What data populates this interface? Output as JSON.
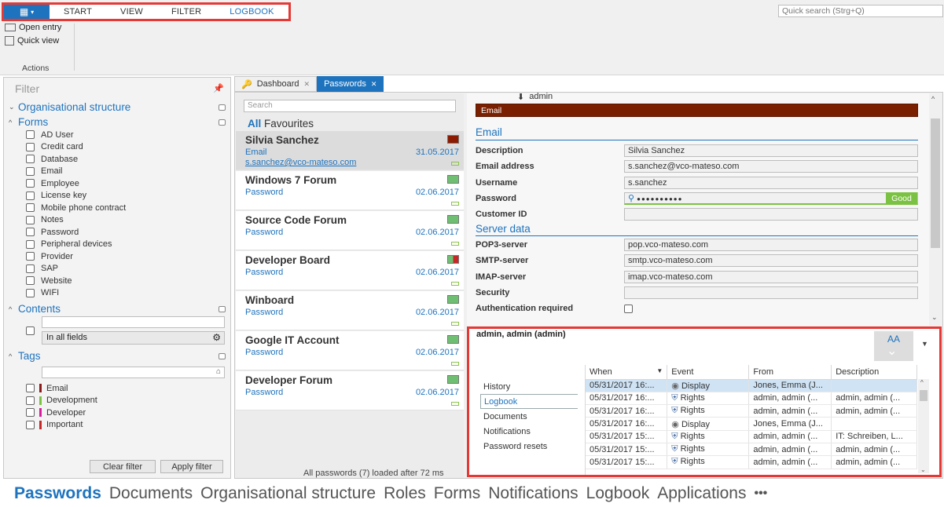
{
  "ribbon": {
    "tabs": [
      "START",
      "VIEW",
      "FILTER",
      "LOGBOOK"
    ],
    "active_tab": "LOGBOOK",
    "quick_search_placeholder": "Quick search (Strg+Q)",
    "actions": {
      "open_entry": "Open entry",
      "quick_view": "Quick view",
      "group_label": "Actions"
    }
  },
  "filter": {
    "title": "Filter",
    "sections": {
      "org": "Organisational structure",
      "forms": "Forms",
      "contents": "Contents",
      "tags": "Tags"
    },
    "forms_items": [
      "AD User",
      "Credit card",
      "Database",
      "Email",
      "Employee",
      "License key",
      "Mobile phone contract",
      "Notes",
      "Password",
      "Peripheral devices",
      "Provider",
      "SAP",
      "Website",
      "WIFI"
    ],
    "contents_scope": "In all fields",
    "tag_items": [
      {
        "label": "Email",
        "color": "#8b1a1a"
      },
      {
        "label": "Development",
        "color": "#7cc242"
      },
      {
        "label": "Developer",
        "color": "#d81b9c"
      },
      {
        "label": "Important",
        "color": "#c62828"
      }
    ],
    "clear_filter": "Clear filter",
    "apply_filter": "Apply filter"
  },
  "doc_tabs": [
    {
      "label": "Dashboard",
      "close": "✕"
    },
    {
      "label": "Passwords",
      "close": "✕"
    }
  ],
  "list": {
    "search_placeholder": "Search",
    "all_label": "All",
    "favourites_label": "Favourites",
    "entries": [
      {
        "title": "Silvia Sanchez",
        "type": "Email",
        "date": "31.05.2017",
        "sub": "s.sanchez@vco-mateso.com",
        "flag": "#8b1a00"
      },
      {
        "title": "Windows 7 Forum",
        "type": "Password",
        "date": "02.06.2017",
        "flag": "#6fbf73"
      },
      {
        "title": "Source Code Forum",
        "type": "Password",
        "date": "02.06.2017",
        "flag": "#6fbf73"
      },
      {
        "title": "Developer Board",
        "type": "Password",
        "date": "02.06.2017",
        "flag": "#6fbf73"
      },
      {
        "title": "Winboard",
        "type": "Password",
        "date": "02.06.2017",
        "flag": "#6fbf73"
      },
      {
        "title": "Google IT Account",
        "type": "Password",
        "date": "02.06.2017",
        "flag": "#6fbf73"
      },
      {
        "title": "Developer Forum",
        "type": "Password",
        "date": "02.06.2017",
        "flag": "#6fbf73"
      }
    ],
    "footer": "All passwords (7) loaded after 72 ms"
  },
  "detail": {
    "owner": "admin",
    "tag_bar": "Email",
    "section_email": "Email",
    "fields_email": [
      {
        "label": "Description",
        "value": "Silvia Sanchez"
      },
      {
        "label": "Email address",
        "value": "s.sanchez@vco-mateso.com"
      },
      {
        "label": "Username",
        "value": "s.sanchez"
      },
      {
        "label": "Password",
        "value": "●●●●●●●●●●"
      },
      {
        "label": "Customer ID",
        "value": ""
      }
    ],
    "password_strength": "Good",
    "section_server": "Server data",
    "fields_server": [
      {
        "label": "POP3-server",
        "value": "pop.vco-mateso.com"
      },
      {
        "label": "SMTP-server",
        "value": "smtp.vco-mateso.com"
      },
      {
        "label": "IMAP-server",
        "value": "imap.vco-mateso.com"
      },
      {
        "label": "Security",
        "value": ""
      },
      {
        "label": "Authentication required",
        "value": ""
      }
    ]
  },
  "logbook": {
    "user": "admin, admin (admin)",
    "avatar_initials": "AA",
    "nav": [
      "History",
      "Logbook",
      "Documents",
      "Notifications",
      "Password resets"
    ],
    "active_nav": "Logbook",
    "columns": [
      "When",
      "Event",
      "From",
      "Description"
    ],
    "rows": [
      {
        "when": "05/31/2017 16:...",
        "event": "Display",
        "from": "Jones, Emma (J...",
        "desc": ""
      },
      {
        "when": "05/31/2017 16:...",
        "event": "Rights",
        "from": "admin, admin (...",
        "desc": "admin, admin (..."
      },
      {
        "when": "05/31/2017 16:...",
        "event": "Rights",
        "from": "admin, admin (...",
        "desc": "admin, admin (..."
      },
      {
        "when": "05/31/2017 16:...",
        "event": "Display",
        "from": "Jones, Emma (J...",
        "desc": ""
      },
      {
        "when": "05/31/2017 15:...",
        "event": "Rights",
        "from": "admin, admin (...",
        "desc": "IT: Schreiben, L..."
      },
      {
        "when": "05/31/2017 15:...",
        "event": "Rights",
        "from": "admin, admin (...",
        "desc": "admin, admin (..."
      },
      {
        "when": "05/31/2017 15:...",
        "event": "Rights",
        "from": "admin, admin (...",
        "desc": "admin, admin (..."
      }
    ]
  },
  "bottom_nav": [
    "Passwords",
    "Documents",
    "Organisational structure",
    "Roles",
    "Forms",
    "Notifications",
    "Logbook",
    "Applications",
    "•••"
  ],
  "colors": {
    "accent": "#1e73be",
    "highlight": "#e53935"
  }
}
